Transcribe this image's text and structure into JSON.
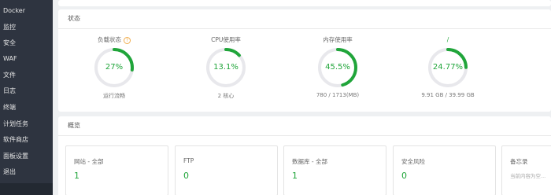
{
  "sidebar": {
    "items": [
      {
        "label": "Docker"
      },
      {
        "label": "监控"
      },
      {
        "label": "安全"
      },
      {
        "label": "WAF"
      },
      {
        "label": "文件"
      },
      {
        "label": "日志"
      },
      {
        "label": "终端"
      },
      {
        "label": "计划任务"
      },
      {
        "label": "软件商店"
      },
      {
        "label": "面板设置"
      },
      {
        "label": "退出"
      }
    ]
  },
  "status": {
    "title": "状态",
    "gauges": [
      {
        "label": "负载状态",
        "value": "27%",
        "percent": 27,
        "sub": "运行流畅",
        "help_icon": "question-circle-icon"
      },
      {
        "label": "CPU使用率",
        "value": "13.1%",
        "percent": 13.1,
        "sub": "2 核心"
      },
      {
        "label": "内存使用率",
        "value": "45.5%",
        "percent": 45.5,
        "sub": "780 / 1713(MB)"
      },
      {
        "label": "/",
        "value": "24.77%",
        "percent": 24.77,
        "sub": "9.91 GB / 39.99 GB"
      }
    ],
    "colors": {
      "accent": "#20a53a",
      "track": "#e8e8ec",
      "help": "#f0ad4e"
    }
  },
  "overview": {
    "title": "概览",
    "cards": [
      {
        "label": "网站 - 全部",
        "value": "1"
      },
      {
        "label": "FTP",
        "value": "0"
      },
      {
        "label": "数据库 - 全部",
        "value": "1"
      },
      {
        "label": "安全风险",
        "value": "0"
      },
      {
        "label": "备忘录",
        "placeholder": "当前内容为空..."
      }
    ]
  }
}
